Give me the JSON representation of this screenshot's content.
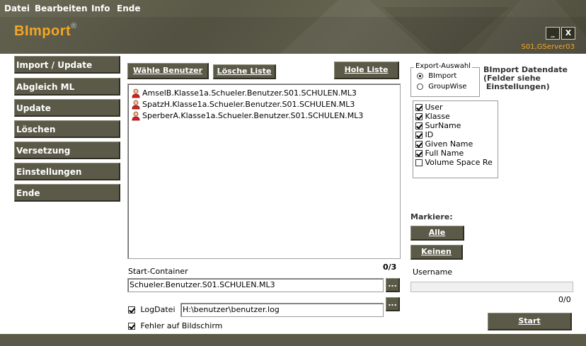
{
  "menu": [
    "Datei",
    "Bearbeiten",
    "Info",
    "Ende"
  ],
  "app": {
    "title": "BImport",
    "registered_mark": "®",
    "server": "S01,GServer03",
    "minimize_label": "_",
    "close_label": "X"
  },
  "sidebar": {
    "items": [
      {
        "label": "Import / Update"
      },
      {
        "label": "Abgleich ML"
      },
      {
        "label": "Update"
      },
      {
        "label": "Löschen"
      },
      {
        "label": "Versetzung"
      },
      {
        "label": "Einstellungen"
      },
      {
        "label": "Ende"
      }
    ]
  },
  "toolbar": {
    "select_users": "Wähle Benutzer",
    "clear_list": "Lösche Liste",
    "fetch_list": "Hole Liste"
  },
  "users": [
    "AmselB.Klasse1a.Schueler.Benutzer.S01.SCHULEN.ML3",
    "SpatzH.Klasse1a.Schueler.Benutzer.S01.SCHULEN.ML3",
    "SperberA.Klasse1a.Schueler.Benutzer.S01.SCHULEN.ML3"
  ],
  "list_count": "0/3",
  "start_container": {
    "label": "Start-Container",
    "value": "Schueler.Benutzer.S01.SCHULEN.ML3",
    "browse": "..."
  },
  "log": {
    "label": "LogDatei",
    "checked": true,
    "value": "H:\\benutzer\\benutzer.log",
    "browse": "..."
  },
  "errors_on_screen": {
    "label": "Fehler auf Bildschirm",
    "checked": true
  },
  "export": {
    "legend": "Export-Auswahl",
    "options": [
      {
        "label": "BImport",
        "selected": true
      },
      {
        "label": "GroupWise",
        "selected": false
      }
    ],
    "note_line1": "BImport Datendate",
    "note_line2": "(Felder siehe",
    "note_line3": " Einstellungen)"
  },
  "fields": [
    {
      "label": "User",
      "checked": true
    },
    {
      "label": "Klasse",
      "checked": true
    },
    {
      "label": "SurName",
      "checked": true
    },
    {
      "label": "ID",
      "checked": true
    },
    {
      "label": "Given Name",
      "checked": true
    },
    {
      "label": "Full Name",
      "checked": true
    },
    {
      "label": "Volume Space Re",
      "checked": false
    }
  ],
  "mark": {
    "label": "Markiere:",
    "all": "Alle",
    "none": "Keinen"
  },
  "username_label": "Username",
  "progress": {
    "fraction": 0,
    "text": "0/0"
  },
  "start_button": "Start",
  "colors": {
    "header_bg": "#5a5947",
    "accent_orange": "#f5a623",
    "button_bg": "#5b5a48"
  }
}
